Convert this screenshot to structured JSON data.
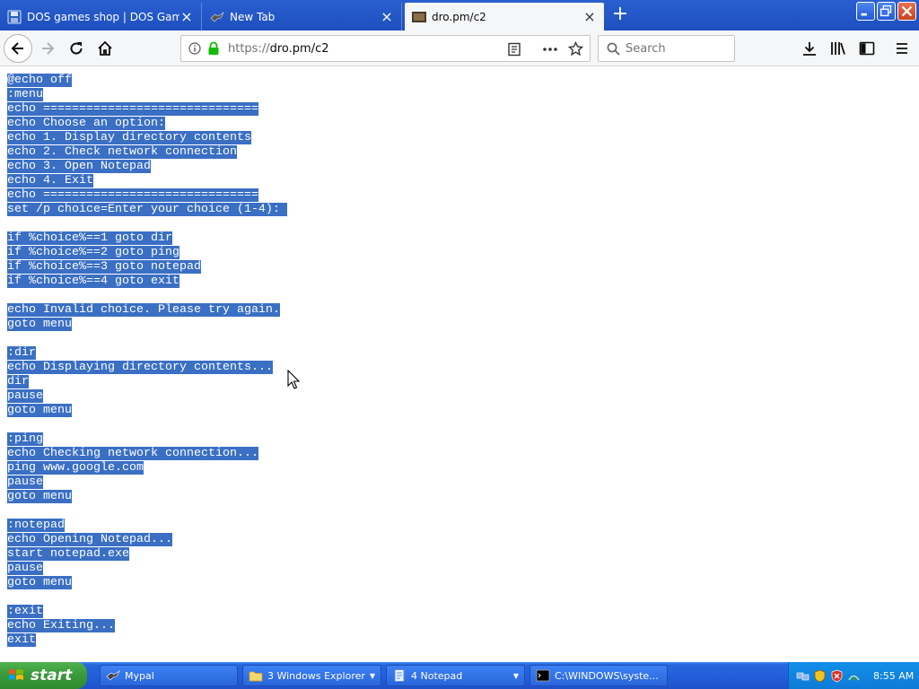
{
  "browser": {
    "tabs": [
      {
        "title": "DOS games shop | DOS Games Ar",
        "active": false
      },
      {
        "title": "New Tab",
        "active": false
      },
      {
        "title": "dro.pm/c2",
        "active": true
      }
    ],
    "url_prefix": "https://",
    "url_host": "dro.pm/c2",
    "search_placeholder": "Search"
  },
  "script_lines": [
    "@echo off",
    ":menu",
    "echo ==============================",
    "echo Choose an option:",
    "echo 1. Display directory contents",
    "echo 2. Check network connection",
    "echo 3. Open Notepad",
    "echo 4. Exit",
    "echo ==============================",
    "set /p choice=Enter your choice (1-4): ",
    "",
    "if %choice%==1 goto dir",
    "if %choice%==2 goto ping",
    "if %choice%==3 goto notepad",
    "if %choice%==4 goto exit",
    "",
    "echo Invalid choice. Please try again.",
    "goto menu",
    "",
    ":dir",
    "echo Displaying directory contents...",
    "dir",
    "pause",
    "goto menu",
    "",
    ":ping",
    "echo Checking network connection...",
    "ping www.google.com",
    "pause",
    "goto menu",
    "",
    ":notepad",
    "echo Opening Notepad...",
    "start notepad.exe",
    "pause",
    "goto menu",
    "",
    ":exit",
    "echo Exiting...",
    "exit"
  ],
  "taskbar": {
    "start_label": "start",
    "buttons": [
      {
        "label": "Mypal",
        "icon": "mypal-icon",
        "has_menu": false
      },
      {
        "label": "3 Windows Explorer",
        "icon": "folder-icon",
        "has_menu": true
      },
      {
        "label": "4 Notepad",
        "icon": "notepad-icon",
        "has_menu": true
      },
      {
        "label": "C:\\WINDOWS\\syste...",
        "icon": "cmd-icon",
        "has_menu": false
      }
    ],
    "clock": "8:55 AM"
  },
  "colors": {
    "selection": "#3a6fc4",
    "titlebar": "#2a5fcf",
    "taskbar": "#245edb",
    "start": "#3a9a3a"
  }
}
